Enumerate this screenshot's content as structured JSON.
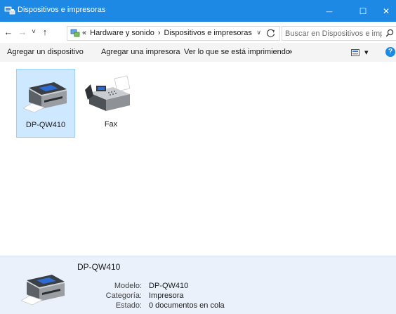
{
  "window": {
    "title": "Dispositivos e impresoras",
    "minimize_glyph": "—",
    "maximize_glyph": "☐",
    "close_glyph": "✕"
  },
  "address": {
    "back_glyph": "←",
    "forward_glyph": "→",
    "recent_glyph": "˅",
    "up_glyph": "↑",
    "overflow_glyph": "«",
    "crumbs": [
      "Hardware y sonido",
      "Dispositivos e impresoras"
    ],
    "separator": "›",
    "dropdown_glyph": "∨",
    "search_placeholder": "Buscar en Dispositivos e impr..."
  },
  "toolbar": {
    "items": [
      "Agregar un dispositivo",
      "Agregar una impresora",
      "Ver lo que se está imprimiendo"
    ],
    "more_glyph": "»",
    "view_dropdown_glyph": "▾",
    "help_glyph": "?"
  },
  "devices": [
    {
      "label": "DP-QW410",
      "icon": "printer-icon",
      "selected": true
    },
    {
      "label": "Fax",
      "icon": "fax-icon",
      "selected": false
    }
  ],
  "details": {
    "name": "DP-QW410",
    "fields": [
      {
        "key": "Modelo:",
        "value": "DP-QW410"
      },
      {
        "key": "Categoría:",
        "value": "Impresora"
      },
      {
        "key": "Estado:",
        "value": "0 documentos en cola"
      }
    ]
  },
  "colors": {
    "titlebar": "#1e88e5",
    "selection": "#cde8ff",
    "help": "#1e88e5"
  }
}
